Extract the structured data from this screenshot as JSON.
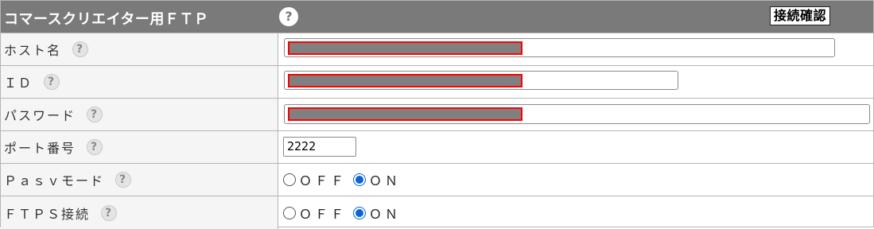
{
  "header": {
    "title": "コマースクリエイター用ＦＴＰ",
    "help_glyph": "?",
    "connect_button": "接続確認"
  },
  "rows": {
    "host": {
      "label": "ホスト名",
      "help": "?"
    },
    "id": {
      "label": "ＩＤ",
      "help": "?"
    },
    "password": {
      "label": "パスワード",
      "help": "?"
    },
    "port": {
      "label": "ポート番号",
      "help": "?",
      "value": "2222"
    },
    "pasv": {
      "label": "Ｐａｓｖモード",
      "help": "?",
      "off": "ＯＦＦ",
      "on": "ＯＮ",
      "selected": "on"
    },
    "ftps": {
      "label": "ＦＴＰＳ接続",
      "help": "?",
      "off": "ＯＦＦ",
      "on": "ＯＮ",
      "selected": "on"
    }
  },
  "colors": {
    "header_bg": "#7a7a7a",
    "redaction": "#808080",
    "redaction_border": "#ff0000",
    "radio_accent": "#0a64d8"
  }
}
